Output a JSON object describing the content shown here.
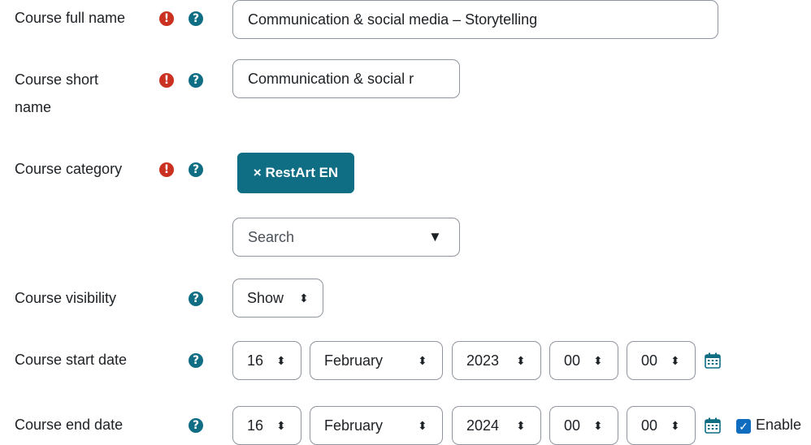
{
  "fields": {
    "full_name": {
      "label": "Course full name",
      "value": "Communication & social media – Storytelling"
    },
    "short_name": {
      "label_line1": "Course short",
      "label_line2": "name",
      "value": "Communication & social r"
    },
    "category": {
      "label": "Course category",
      "tag": "× RestArt EN",
      "search_placeholder": "Search",
      "dropdown_glyph": "▼"
    },
    "visibility": {
      "label": "Course visibility",
      "value": "Show"
    },
    "start_date": {
      "label": "Course start date",
      "day": "16",
      "month": "February",
      "year": "2023",
      "hour": "00",
      "minute": "00"
    },
    "end_date": {
      "label": "Course end date",
      "day": "16",
      "month": "February",
      "year": "2024",
      "hour": "00",
      "minute": "00",
      "enable_label": "Enable"
    }
  },
  "icons": {
    "required": {
      "glyph": "!",
      "color": "#ca3120"
    },
    "help": {
      "glyph": "?",
      "color": "#0f6e84"
    },
    "select_arrow": "⬍",
    "checkbox_check": "✓"
  },
  "colors": {
    "accent": "#0f6e84",
    "checkbox": "#0f6cbf",
    "border": "#8f959e"
  }
}
